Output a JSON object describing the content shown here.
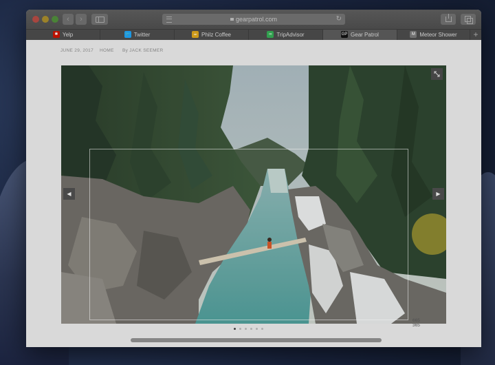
{
  "browser": {
    "url": "gearpatrol.com",
    "tabs": [
      {
        "label": "Yelp",
        "icon": "yelp-icon",
        "color": "#c41200"
      },
      {
        "label": "Twitter",
        "icon": "twitter-bird-icon",
        "color": "#1da1f2"
      },
      {
        "label": "Philz Coffee",
        "icon": "philz-coffee-icon",
        "color": "#d9a21b"
      },
      {
        "label": "TripAdvisor",
        "icon": "tripadvisor-owl-icon",
        "color": "#34a853"
      },
      {
        "label": "Gear Patrol",
        "icon": "gear-patrol-icon",
        "color": "#111111",
        "active": true
      },
      {
        "label": "Meteor Shower",
        "icon": "meteor-shower-icon",
        "color": "#777777"
      }
    ]
  },
  "article": {
    "date": "JUNE 29, 2017",
    "section": "HOME",
    "byline": "By JACK SEEMER"
  },
  "gallery": {
    "image_subject": "river canyon with log bridge",
    "dims_line1": "665",
    "dims_line2": "365",
    "slide_count": 6,
    "active_slide": 0
  }
}
